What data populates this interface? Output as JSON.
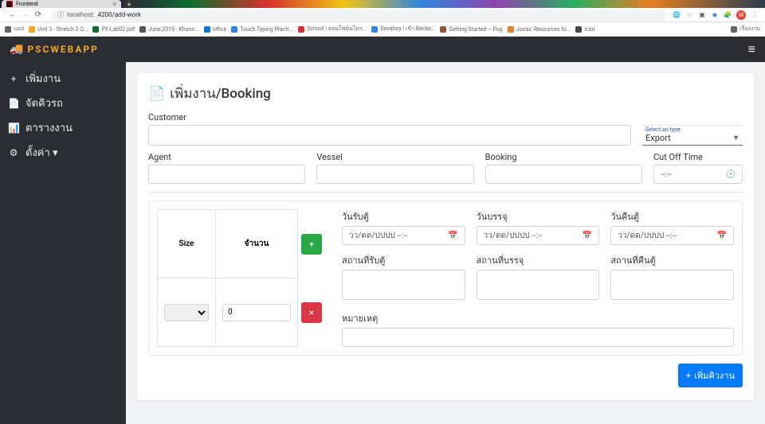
{
  "browser": {
    "tab_title": "Frontend",
    "url_prefix": "localhost:",
    "url_path": "4200/add-work",
    "avatar": "M",
    "bookmarks": [
      "แอป",
      "Unit 3 - Stretch 3 O...",
      "PY-Lab02.pdf",
      "June 2019 - Khano...",
      "office",
      "Touch Typing Practi...",
      "School | สอนโซ่มินไทร...",
      "Devahoy | เข้า Backe...",
      "Getting Started – Pug",
      "Jonas' Resources fo...",
      "icon",
      "เรื่องงาน"
    ]
  },
  "app": {
    "logo_text": "PSCWEBAPP",
    "sidebar": [
      {
        "icon": "+",
        "label": "เพิ่มงาน"
      },
      {
        "icon": "📄",
        "label": "จัดคิวรถ"
      },
      {
        "icon": "📊",
        "label": "ตารางงาน"
      },
      {
        "icon": "⚙",
        "label": "ตั้งค่า ▾"
      }
    ],
    "page_title": "เพิ่มงาน/Booking",
    "labels": {
      "customer": "Customer",
      "select_type": "Select an type",
      "type_value": "Export",
      "agent": "Agent",
      "vessel": "Vessel",
      "booking": "Booking",
      "cut_off": "Cut Off Time",
      "time_ph": "--:--",
      "size": "Size",
      "qty": "จำนวน",
      "qty_value": "0",
      "date_pickup": "วันรับตู้",
      "date_pack": "วันบรรจุ",
      "date_return": "วันคืนตู้",
      "date_ph": "วว/ดด/ปปปป --:--",
      "place_pickup": "สถานที่รับตู้",
      "place_pack": "สถานที่บรรจุ",
      "place_return": "สถานที่คืนตู้",
      "note": "หมายเหตุ",
      "add_queue_btn": "เพิ่มคิวงาน"
    }
  }
}
